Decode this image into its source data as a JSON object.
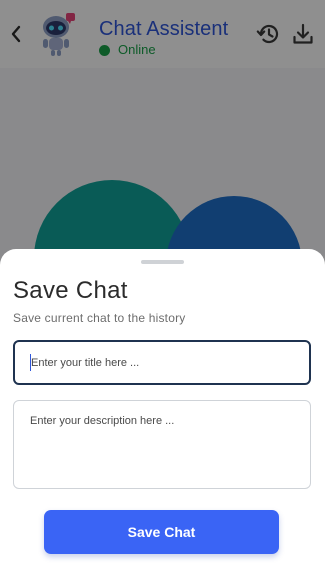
{
  "header": {
    "title": "Chat Assistent",
    "status": "Online",
    "icons": {
      "back": "chevron-left-icon",
      "avatar": "robot-avatar",
      "history": "history-icon",
      "download": "download-icon"
    }
  },
  "sheet": {
    "title": "Save Chat",
    "subtitle": "Save current chat to the history",
    "title_placeholder": "Enter your title here ...",
    "description_placeholder": "Enter your description here ...",
    "save_label": "Save Chat"
  },
  "colors": {
    "accent": "#3a64f5",
    "title": "#2f56d9",
    "online": "#1aa34a",
    "input_border_focused": "#1f3350"
  }
}
